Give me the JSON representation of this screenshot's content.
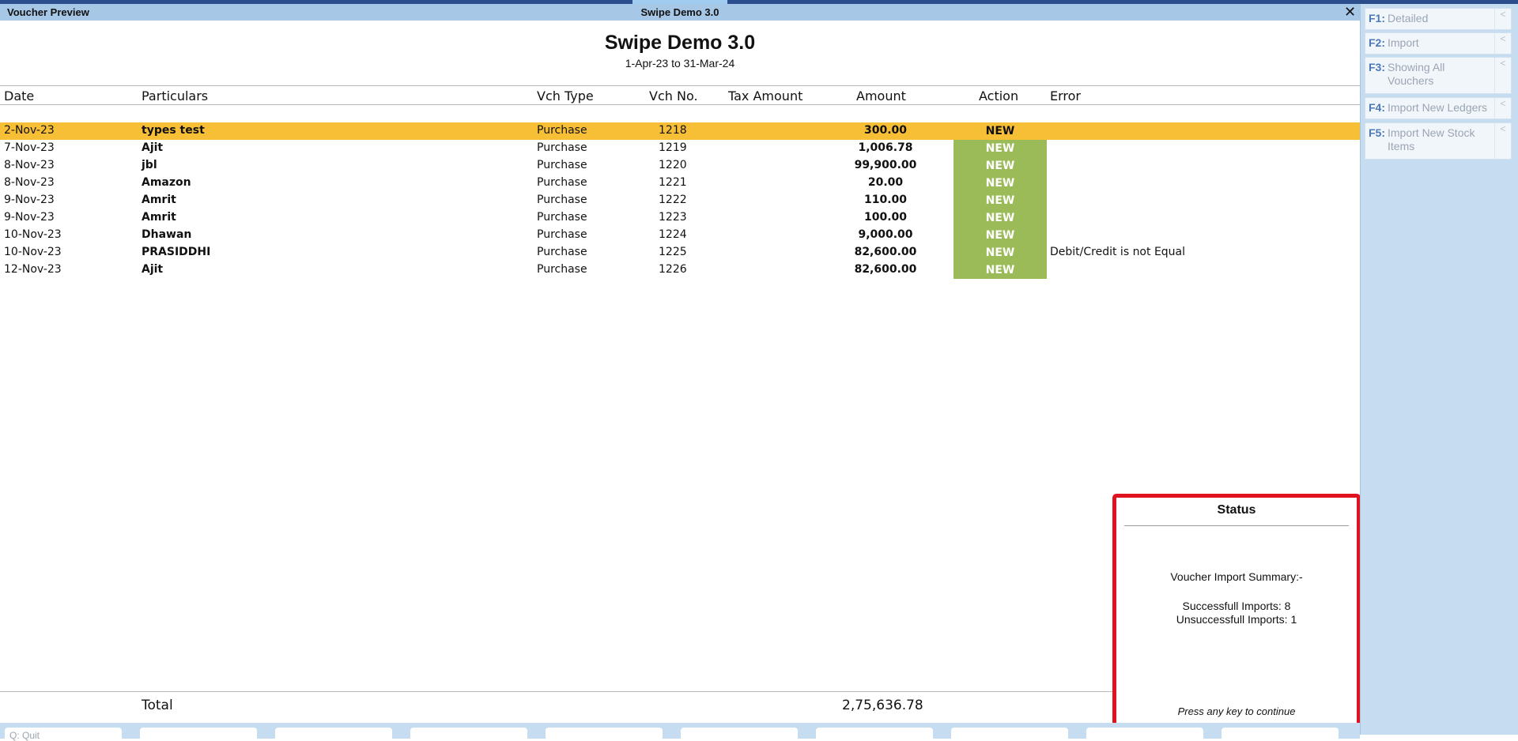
{
  "window": {
    "left_title": "Voucher Preview",
    "center_title": "Swipe Demo 3.0",
    "close_glyph": "✕"
  },
  "report": {
    "company": "Swipe Demo 3.0",
    "period": "1-Apr-23 to 31-Mar-24"
  },
  "columns": {
    "date": "Date",
    "particulars": "Particulars",
    "vch_type": "Vch Type",
    "vch_no": "Vch No.",
    "tax_amount": "Tax Amount",
    "amount": "Amount",
    "action": "Action",
    "error": "Error"
  },
  "rows": [
    {
      "date": "2-Nov-23",
      "particulars": "types test",
      "vch_type": "Purchase",
      "vch_no": "1218",
      "amount": "300.00",
      "action": "NEW",
      "error": ""
    },
    {
      "date": "7-Nov-23",
      "particulars": "Ajit",
      "vch_type": "Purchase",
      "vch_no": "1219",
      "amount": "1,006.78",
      "action": "NEW",
      "error": ""
    },
    {
      "date": "8-Nov-23",
      "particulars": "jbl",
      "vch_type": "Purchase",
      "vch_no": "1220",
      "amount": "99,900.00",
      "action": "NEW",
      "error": ""
    },
    {
      "date": "8-Nov-23",
      "particulars": "Amazon",
      "vch_type": "Purchase",
      "vch_no": "1221",
      "amount": "20.00",
      "action": "NEW",
      "error": ""
    },
    {
      "date": "9-Nov-23",
      "particulars": "Amrit",
      "vch_type": "Purchase",
      "vch_no": "1222",
      "amount": "110.00",
      "action": "NEW",
      "error": ""
    },
    {
      "date": "9-Nov-23",
      "particulars": "Amrit",
      "vch_type": "Purchase",
      "vch_no": "1223",
      "amount": "100.00",
      "action": "NEW",
      "error": ""
    },
    {
      "date": "10-Nov-23",
      "particulars": "Dhawan",
      "vch_type": "Purchase",
      "vch_no": "1224",
      "amount": "9,000.00",
      "action": "NEW",
      "error": ""
    },
    {
      "date": "10-Nov-23",
      "particulars": "PRASIDDHI",
      "vch_type": "Purchase",
      "vch_no": "1225",
      "amount": "82,600.00",
      "action": "NEW",
      "error": "Debit/Credit is not Equal"
    },
    {
      "date": "12-Nov-23",
      "particulars": "Ajit",
      "vch_type": "Purchase",
      "vch_no": "1226",
      "amount": "82,600.00",
      "action": "NEW",
      "error": ""
    }
  ],
  "total": {
    "label": "Total",
    "value": "2,75,636.78"
  },
  "status_dialog": {
    "title": "Status",
    "summary": "Voucher Import Summary:-",
    "success": "Successfull Imports: 8",
    "fail": "Unsuccessfull Imports: 1",
    "prompt": "Press any key to continue"
  },
  "bottom_bar": {
    "quit_label": "Q: Quit"
  },
  "side_panel": [
    {
      "key": "F1:",
      "label": "Detailed"
    },
    {
      "key": "F2:",
      "label": "Import"
    },
    {
      "key": "F3:",
      "label": "Showing All Vouchers"
    },
    {
      "key": "F4:",
      "label": "Import New Ledgers"
    },
    {
      "key": "F5:",
      "label": "Import New Stock Items"
    }
  ],
  "colors": {
    "title_bar": "#a7c7e7",
    "selected_row": "#f7bf36",
    "action_new": "#9bbb59",
    "status_border": "#e0121f",
    "side_panel": "#c6dcf1"
  }
}
